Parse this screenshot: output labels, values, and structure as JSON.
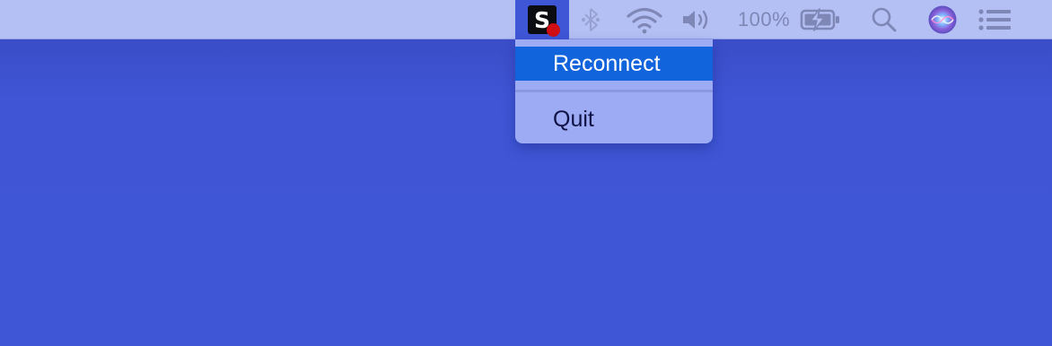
{
  "menubar": {
    "app_logo_letter": "S",
    "battery_percent": "100%",
    "icons": {
      "app": "status-app-icon",
      "bluetooth": "bluetooth-icon",
      "wifi": "wifi-icon",
      "volume": "volume-icon",
      "battery": "battery-charging-icon",
      "search": "spotlight-search-icon",
      "siri": "siri-icon",
      "notifications": "notification-center-icon"
    }
  },
  "dropdown": {
    "items": [
      {
        "label": "Reconnect",
        "highlighted": true
      },
      {
        "label": "Quit",
        "highlighted": false
      }
    ]
  },
  "colors": {
    "desktop": "#3f56d6",
    "menubar": "#b4c0f4",
    "menu_background": "#9cabf4",
    "highlight": "#1264dd",
    "status_dot": "#d00f14"
  }
}
